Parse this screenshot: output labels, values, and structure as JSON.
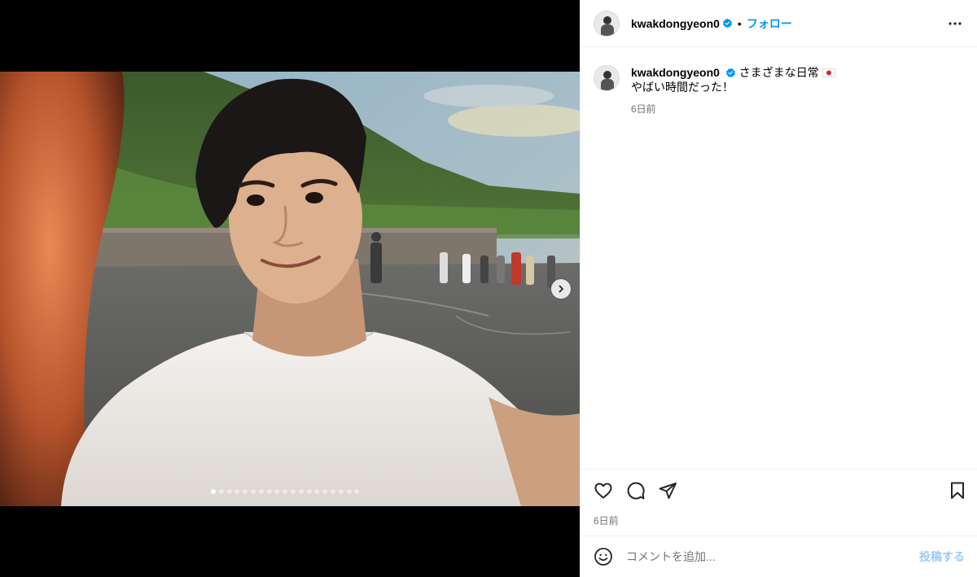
{
  "post": {
    "username": "kwakdongyeon0",
    "follow_label": "フォロー",
    "separator": "•",
    "caption_line1": "さまざまな日常",
    "caption_line2": "やばい時間だった！",
    "caption_age": "6日前",
    "post_age": "6日前",
    "carousel_total_dots": 19,
    "carousel_current_index": 0
  },
  "comment": {
    "placeholder": "コメントを追加...",
    "post_label": "投稿する"
  },
  "icons": {
    "verified": "verified-badge-icon",
    "more": "more-options-icon",
    "like": "heart-icon",
    "comment": "comment-icon",
    "share": "paper-plane-icon",
    "save": "bookmark-icon",
    "emoji": "emoji-icon",
    "next": "chevron-right-icon",
    "flag": "japan-flag-icon"
  },
  "colors": {
    "accent": "#0095f6",
    "muted": "#737373",
    "post_disabled": "#9dcbf4"
  }
}
